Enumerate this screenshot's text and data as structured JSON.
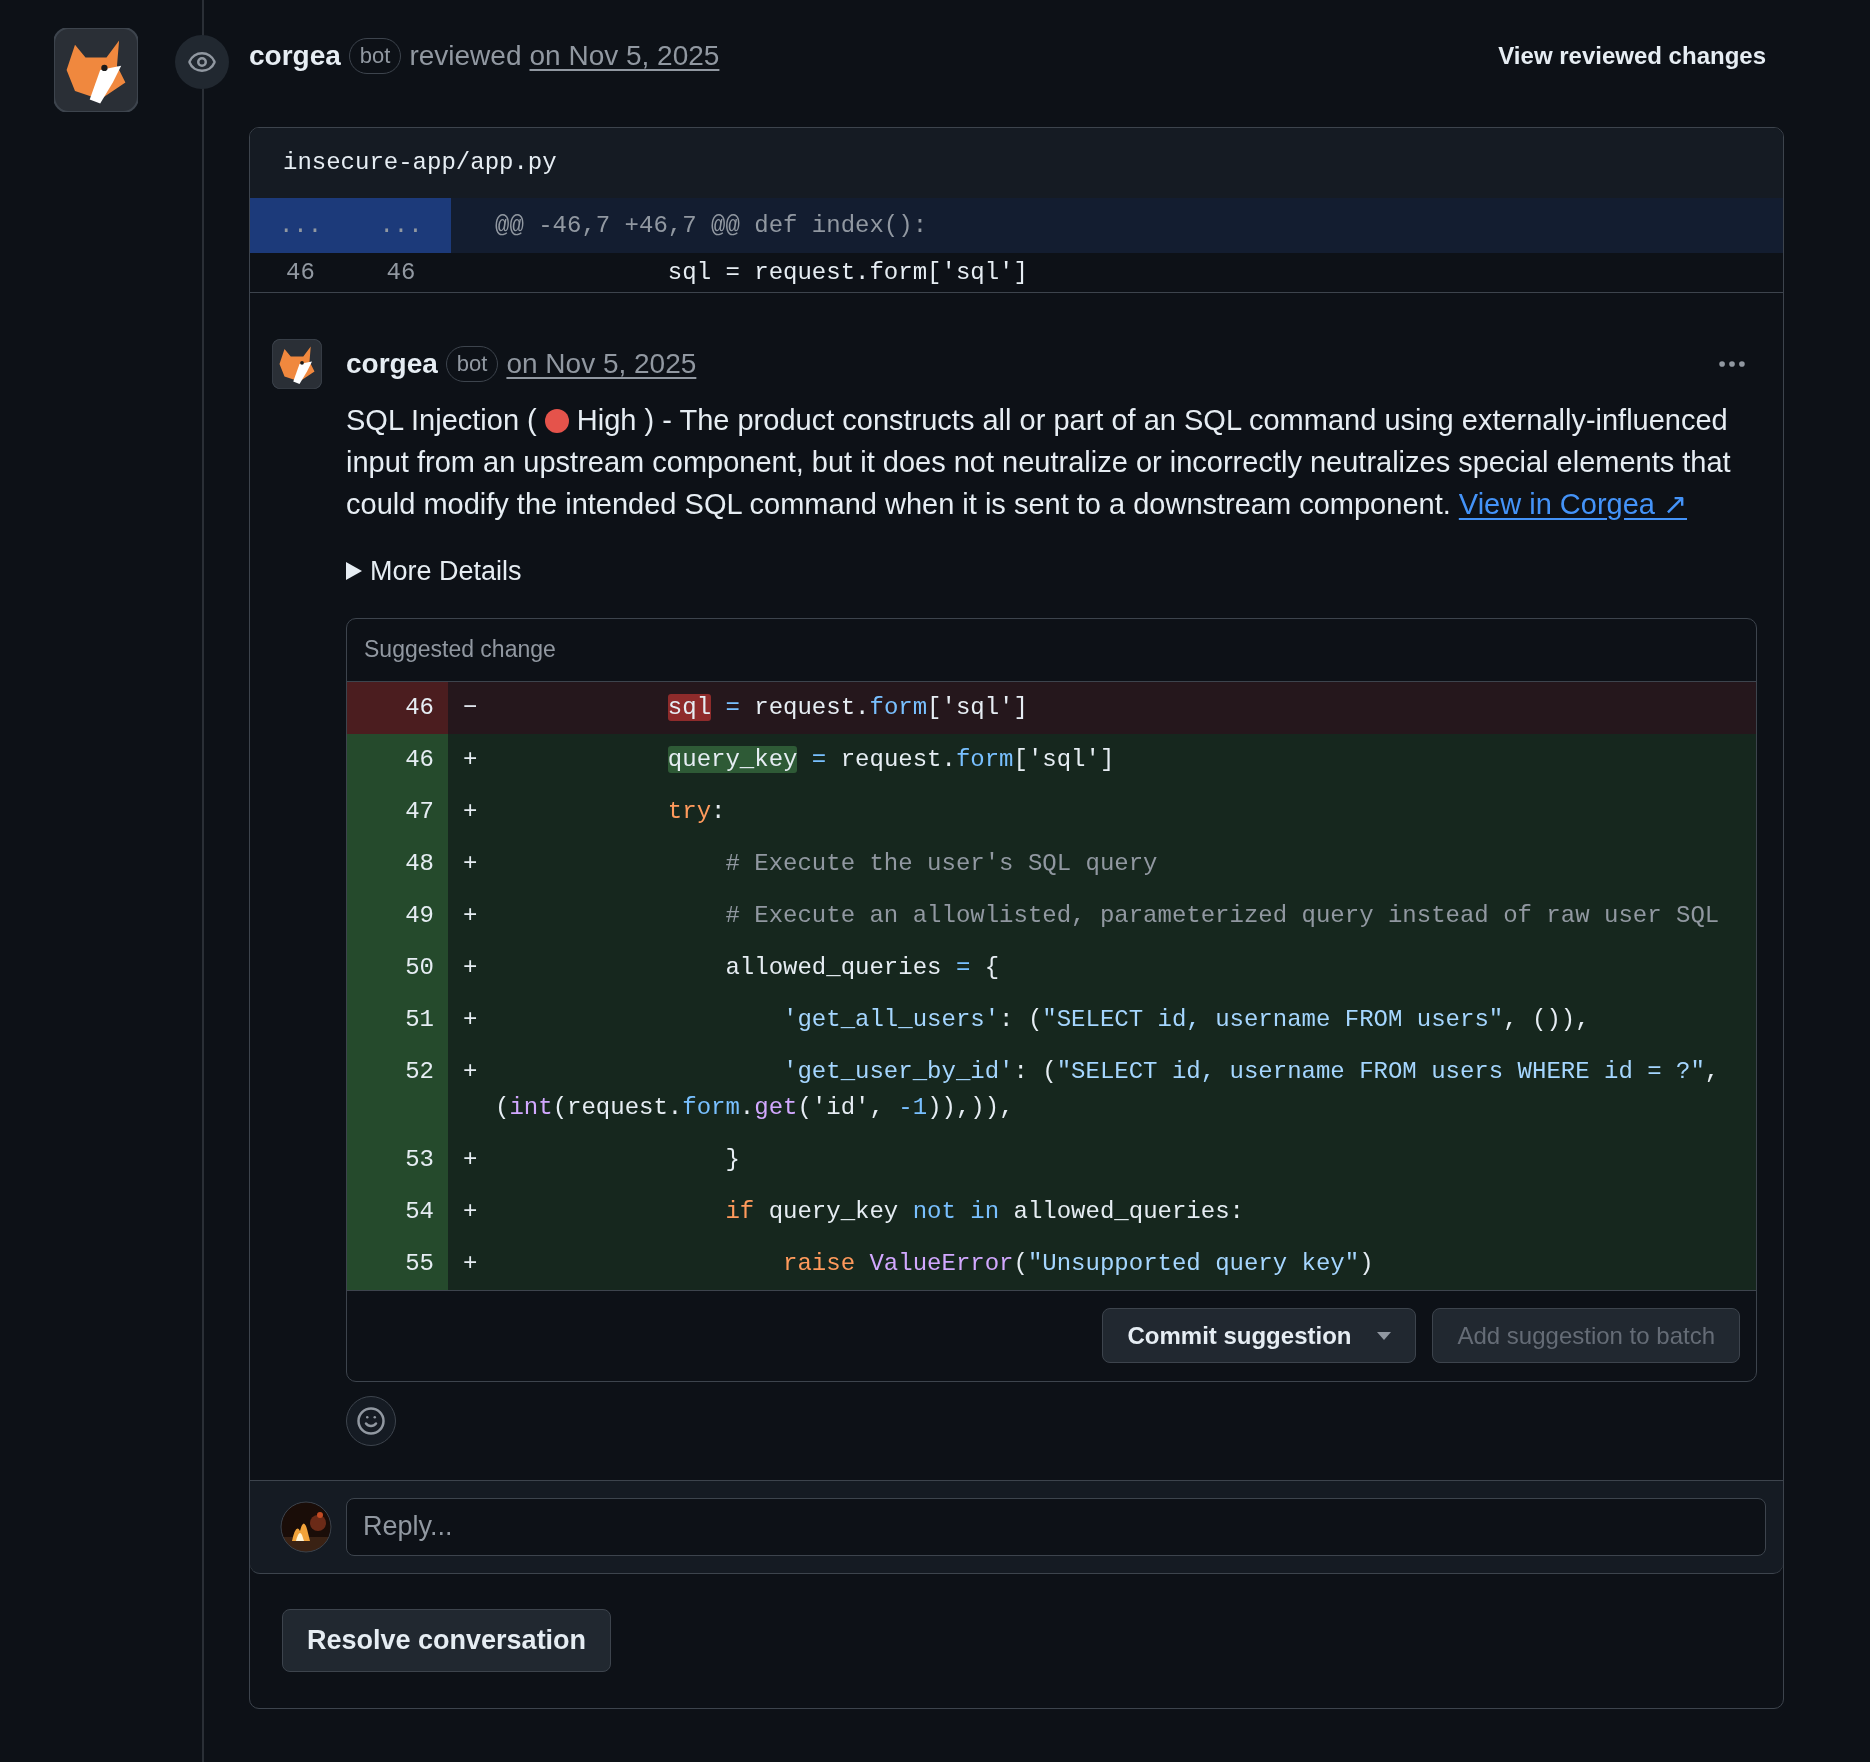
{
  "review": {
    "author": "corgea",
    "badge": "bot",
    "action": "reviewed",
    "date": "on Nov 5, 2025",
    "view_changes": "View reviewed changes"
  },
  "file": {
    "path": "insecure-app/app.py",
    "hunk": {
      "old": "...",
      "new": "...",
      "header": "@@ -46,7 +46,7 @@ def index():"
    },
    "context_line": {
      "old": "46",
      "new": "46",
      "code": "            sql = request.form['sql']"
    }
  },
  "comment": {
    "author": "corgea",
    "badge": "bot",
    "date": "on Nov 5, 2025",
    "body_before": "SQL Injection (",
    "body_after": "High ) - The product constructs all or part of an SQL command using externally-influenced input from an upstream component, but it does not neutralize or incorrectly neutralizes special elements that could modify the intended SQL command when it is sent to a downstream component.",
    "link": "View in Corgea ↗",
    "details": {
      "label": "More Details",
      "expanded": false
    }
  },
  "suggestion": {
    "title": "Suggested change",
    "lines": [
      {
        "num": "46",
        "sign": "−",
        "kind": "deleted",
        "tokens": [
          {
            "text": "            sql",
            "kind": "del-hl"
          },
          {
            "text": " =",
            "kind": "builtin"
          },
          {
            "text": " request.",
            "kind": "plain"
          },
          {
            "text": "form",
            "kind": "builtin"
          },
          {
            "text": "['sql']",
            "kind": "plain"
          }
        ]
      },
      {
        "num": "46",
        "sign": "+",
        "kind": "added",
        "tokens": [
          {
            "text": "            query_key",
            "kind": "add-hl"
          },
          {
            "text": " =",
            "kind": "builtin"
          },
          {
            "text": " request.",
            "kind": "plain"
          },
          {
            "text": "form",
            "kind": "builtin"
          },
          {
            "text": "['sql']",
            "kind": "plain"
          }
        ]
      },
      {
        "num": "47",
        "sign": "+",
        "kind": "added",
        "tokens": [
          {
            "text": "            try",
            "kind": "keyword"
          },
          {
            "text": ":",
            "kind": "plain"
          }
        ]
      },
      {
        "num": "48",
        "sign": "+",
        "kind": "added",
        "tokens": [
          {
            "text": "                # Execute the user's SQL query",
            "kind": "comment"
          }
        ]
      },
      {
        "num": "49",
        "sign": "+",
        "kind": "added",
        "tokens": [
          {
            "text": "                # Execute an allowlisted, parameterized query instead of raw user SQL",
            "kind": "comment"
          }
        ]
      },
      {
        "num": "50",
        "sign": "+",
        "kind": "added",
        "tokens": [
          {
            "text": "                allowed_queries",
            "kind": "plain"
          },
          {
            "text": " =",
            "kind": "builtin"
          },
          {
            "text": " {",
            "kind": "plain"
          }
        ]
      },
      {
        "num": "51",
        "sign": "+",
        "kind": "added",
        "tokens": [
          {
            "text": "                    'get_all_users'",
            "kind": "string"
          },
          {
            "text": ": (",
            "kind": "plain"
          },
          {
            "text": "\"SELECT id, username FROM users\"",
            "kind": "string"
          },
          {
            "text": ", ()),",
            "kind": "plain"
          }
        ]
      },
      {
        "num": "52",
        "sign": "+",
        "kind": "added",
        "tokens": [
          {
            "text": "                    'get_user_by_id'",
            "kind": "string"
          },
          {
            "text": ": (",
            "kind": "plain"
          },
          {
            "text": "\"SELECT id, username FROM users WHERE id = ?\"",
            "kind": "string"
          },
          {
            "text": ", (",
            "kind": "plain"
          },
          {
            "text": "int",
            "kind": "func"
          },
          {
            "text": "(request.",
            "kind": "plain"
          },
          {
            "text": "form",
            "kind": "builtin"
          },
          {
            "text": ".",
            "kind": "plain"
          },
          {
            "text": "get",
            "kind": "func"
          },
          {
            "text": "(",
            "kind": "plain"
          },
          {
            "text": "'id'",
            "kind": "plain"
          },
          {
            "text": ",",
            "kind": "plain"
          },
          {
            "text": " -1",
            "kind": "builtin"
          },
          {
            "text": ")),)),",
            "kind": "plain"
          }
        ]
      },
      {
        "num": "53",
        "sign": "+",
        "kind": "added",
        "tokens": [
          {
            "text": "                }",
            "kind": "plain"
          }
        ]
      },
      {
        "num": "54",
        "sign": "+",
        "kind": "added",
        "tokens": [
          {
            "text": "                if",
            "kind": "keyword"
          },
          {
            "text": " query_key",
            "kind": "plain"
          },
          {
            "text": " not",
            "kind": "builtin"
          },
          {
            "text": " in",
            "kind": "builtin"
          },
          {
            "text": " allowed_queries:",
            "kind": "plain"
          }
        ]
      },
      {
        "num": "55",
        "sign": "+",
        "kind": "added",
        "tokens": [
          {
            "text": "                    raise",
            "kind": "keyword"
          },
          {
            "text": " ValueError",
            "kind": "func"
          },
          {
            "text": "(",
            "kind": "plain"
          },
          {
            "text": "\"Unsupported query key\"",
            "kind": "string"
          },
          {
            "text": ")",
            "kind": "plain"
          }
        ]
      }
    ],
    "commit_button": {
      "label": "Commit suggestion",
      "disabled": false
    },
    "batch_button": {
      "label": "Add suggestion to batch",
      "disabled": true
    }
  },
  "reply": {
    "placeholder": "Reply..."
  },
  "resolve_button": "Resolve conversation"
}
